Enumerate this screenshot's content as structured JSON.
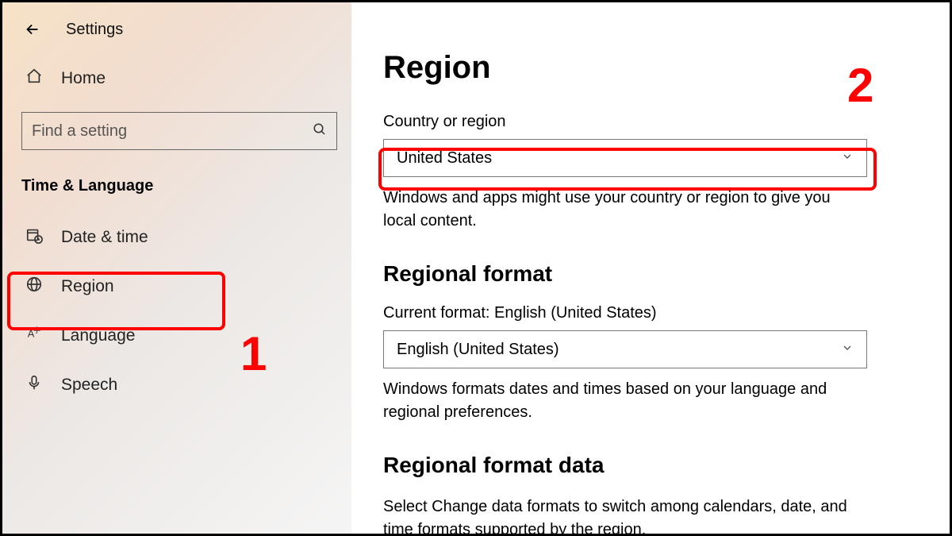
{
  "header": {
    "title": "Settings"
  },
  "sidebar": {
    "home_label": "Home",
    "search_placeholder": "Find a setting",
    "section_title": "Time & Language",
    "items": [
      {
        "label": "Date & time"
      },
      {
        "label": "Region"
      },
      {
        "label": "Language"
      },
      {
        "label": "Speech"
      }
    ]
  },
  "main": {
    "page_title": "Region",
    "country_label": "Country or region",
    "country_value": "United States",
    "country_desc": "Windows and apps might use your country or region to give you local content.",
    "regional_format_title": "Regional format",
    "current_format_label": "Current format: English (United States)",
    "format_value": "English (United States)",
    "format_desc": "Windows formats dates and times based on your language and regional preferences.",
    "format_data_title": "Regional format data",
    "format_data_desc": "Select Change data formats to switch among calendars, date, and time formats supported by the region."
  },
  "annotations": {
    "one": "1",
    "two": "2"
  }
}
